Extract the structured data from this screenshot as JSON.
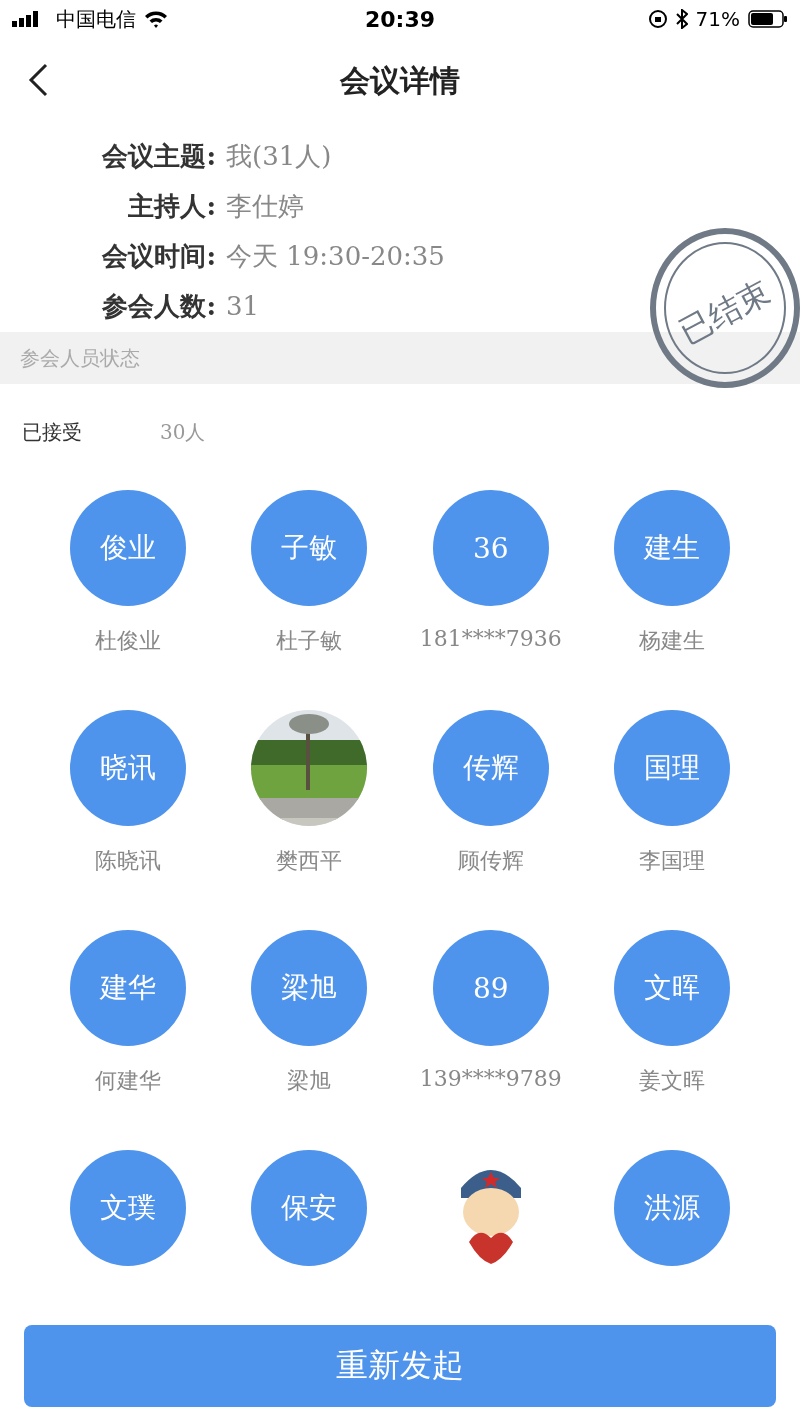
{
  "status_bar": {
    "carrier": "中国电信",
    "time": "20:39",
    "battery": "71%"
  },
  "nav": {
    "title": "会议详情"
  },
  "details": [
    {
      "label": "会议主题:",
      "value": "我(31人)"
    },
    {
      "label": "主持人:",
      "value": "李仕婷"
    },
    {
      "label": "会议时间:",
      "value": "今天 19:30-20:35"
    },
    {
      "label": "参会人数:",
      "value": "31"
    }
  ],
  "stamp": {
    "text": "已结束"
  },
  "section": {
    "title": "参会人员状态"
  },
  "accepted": {
    "label": "已接受",
    "count": "30人"
  },
  "participants": [
    {
      "kind": "text",
      "initials": "俊业",
      "name": "杜俊业"
    },
    {
      "kind": "text",
      "initials": "子敏",
      "name": "杜子敏"
    },
    {
      "kind": "text",
      "initials": "36",
      "name": "181****7936"
    },
    {
      "kind": "text",
      "initials": "建生",
      "name": "杨建生"
    },
    {
      "kind": "text",
      "initials": "晓讯",
      "name": "陈晓讯"
    },
    {
      "name": "樊西平"
    },
    {
      "kind": "text",
      "initials": "传辉",
      "name": "顾传辉"
    },
    {
      "kind": "text",
      "initials": "国理",
      "name": "李国理"
    },
    {
      "kind": "text",
      "initials": "建华",
      "name": "何建华"
    },
    {
      "kind": "text",
      "initials": "梁旭",
      "name": "梁旭"
    },
    {
      "kind": "text",
      "initials": "89",
      "name": "139****9789"
    },
    {
      "kind": "text",
      "initials": "文晖",
      "name": "姜文晖"
    },
    {
      "kind": "text",
      "initials": "文璞"
    },
    {
      "kind": "text",
      "initials": "保安"
    },
    {
      "kind": "cartoon"
    },
    {
      "kind": "text",
      "initials": "洪源"
    }
  ],
  "button": {
    "label": "重新发起"
  }
}
